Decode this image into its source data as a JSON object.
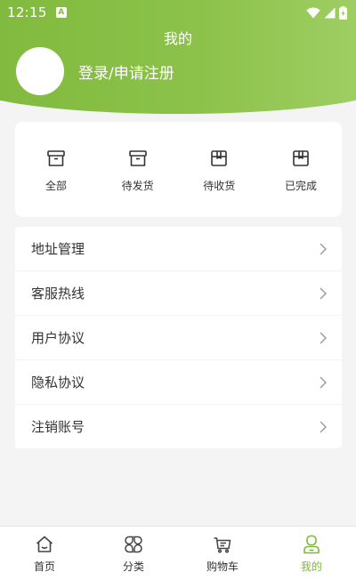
{
  "status_bar": {
    "time": "12:15",
    "notification_icon": "a-icon",
    "icons": [
      "wifi-icon",
      "signal-icon",
      "battery-icon"
    ]
  },
  "header": {
    "title": "我的",
    "login_text": "登录/申请注册"
  },
  "orders": [
    {
      "label": "全部",
      "icon": "box-icon"
    },
    {
      "label": "待发货",
      "icon": "box-icon"
    },
    {
      "label": "待收货",
      "icon": "package-icon"
    },
    {
      "label": "已完成",
      "icon": "package-icon"
    }
  ],
  "menu": [
    {
      "label": "地址管理"
    },
    {
      "label": "客服热线"
    },
    {
      "label": "用户协议"
    },
    {
      "label": "隐私协议"
    },
    {
      "label": "注销账号"
    }
  ],
  "bottom_nav": [
    {
      "label": "首页",
      "icon": "home-icon",
      "active": false
    },
    {
      "label": "分类",
      "icon": "category-icon",
      "active": false
    },
    {
      "label": "购物车",
      "icon": "cart-icon",
      "active": false
    },
    {
      "label": "我的",
      "icon": "user-icon",
      "active": true
    }
  ],
  "colors": {
    "accent": "#7cb93a",
    "header_start": "#7fb93d",
    "header_end": "#a3d068",
    "background": "#f4f4f4"
  }
}
